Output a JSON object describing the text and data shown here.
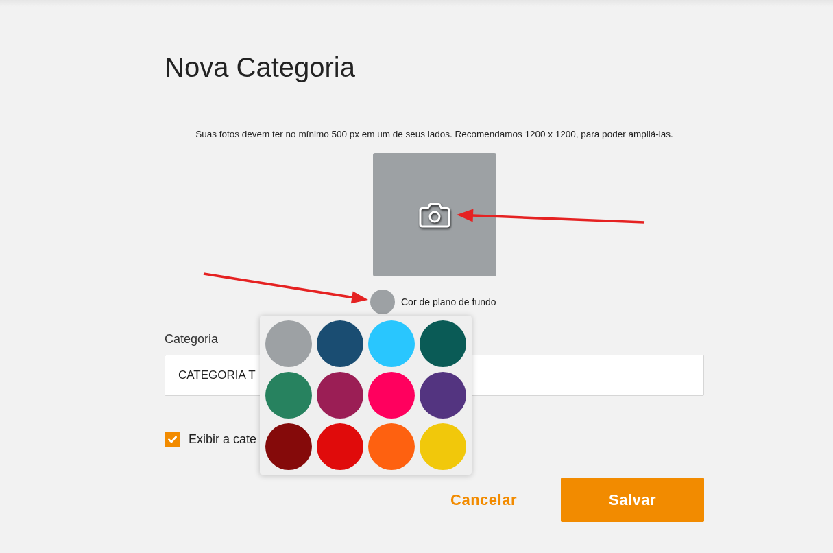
{
  "page": {
    "title": "Nova Categoria"
  },
  "photo": {
    "hint": "Suas fotos devem ter no mínimo 500 px em um de seus lados. Recomendamos 1200 x 1200, para poder ampliá-las."
  },
  "background_picker": {
    "label": "Cor de plano de fundo",
    "color": "#9da1a4",
    "expanded": true,
    "palette": [
      {
        "color": "#9da1a4"
      },
      {
        "color": "#1a4d72"
      },
      {
        "color": "#29c6fe"
      },
      {
        "color": "#0a5b56"
      },
      {
        "color": "#27825f"
      },
      {
        "color": "#9b1e55"
      },
      {
        "color": "#ff005e"
      },
      {
        "color": "#533480"
      },
      {
        "color": "#850a0a"
      },
      {
        "color": "#e00b0b"
      },
      {
        "color": "#fe6110"
      },
      {
        "color": "#f1c80b"
      }
    ]
  },
  "category_field": {
    "label": "Categoria",
    "value": "CATEGORIA T"
  },
  "visibility": {
    "label": "Exibir a cate",
    "checked": true
  },
  "buttons": [
    {
      "label": "Cancelar",
      "kind": "link"
    },
    {
      "label": "Salvar",
      "kind": "primary"
    }
  ]
}
